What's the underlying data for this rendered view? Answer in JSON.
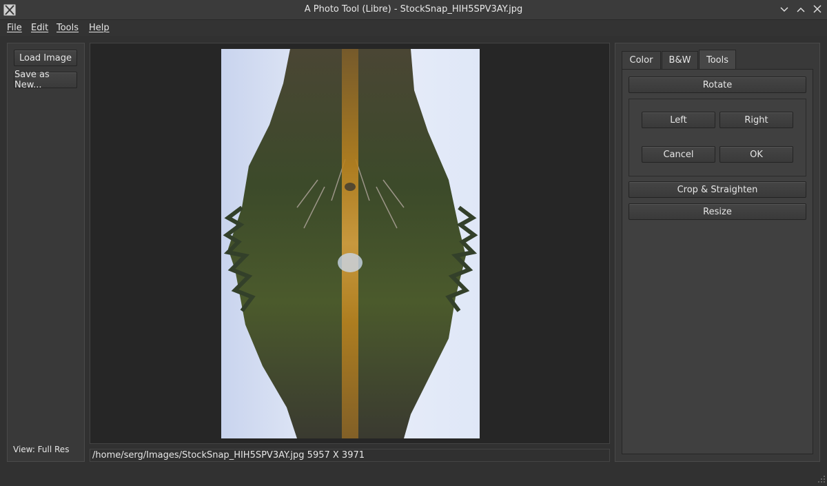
{
  "window": {
    "title": "A Photo Tool (Libre) - StockSnap_HIH5SPV3AY.jpg"
  },
  "menu": [
    {
      "label": "File"
    },
    {
      "label": "Edit"
    },
    {
      "label": "Tools"
    },
    {
      "label": "Help"
    }
  ],
  "left_panel": {
    "load_button": "Load Image",
    "save_button": "Save as New...",
    "view_label": "View: Full Res"
  },
  "status": {
    "path_text": "/home/serg/Images/StockSnap_HIH5SPV3AY.jpg 5957 X 3971"
  },
  "tabs": [
    {
      "label": "Color",
      "active": false
    },
    {
      "label": "B&W",
      "active": false
    },
    {
      "label": "Tools",
      "active": true
    }
  ],
  "tools_tab": {
    "rotate_button": "Rotate",
    "left_button": "Left",
    "right_button": "Right",
    "cancel_button": "Cancel",
    "ok_button": "OK",
    "crop_button": "Crop & Straighten",
    "resize_button": "Resize"
  },
  "colors": {
    "background": "#313131",
    "canvas": "#262626",
    "sky": "#dfe7f7",
    "trees": "#3c4a2a",
    "reflection_strip": "#b9821f"
  },
  "icons": {
    "app": "app-x-icon",
    "minimize": "chevron-down-icon",
    "maximize": "chevron-up-icon",
    "resize_grip": "resize-grip-icon"
  }
}
